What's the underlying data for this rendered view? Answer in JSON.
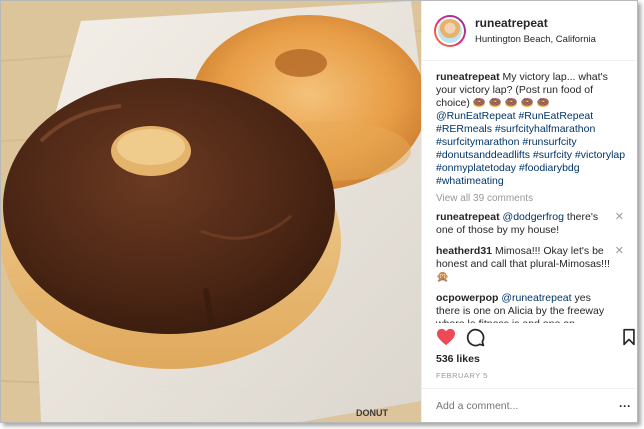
{
  "post": {
    "username": "runeatrepeat",
    "location": "Huntington Beach, California",
    "caption_text": "My victory lap... what's your victory lap? (Post run food of choice)",
    "caption_emoji": "🍩 🍩 🍩 🍩 🍩",
    "hashtags": "@RunEatRepeat #RunEatRepeat #RERmeals #surfcityhalfmarathon #surfcitymarathon #runsurfcity #donutsanddeadlifts #surfcity #victorylap #onmyplatetoday #foodiarybdg #whatimeating",
    "view_all": "View all 39 comments",
    "likes": "536 likes",
    "date": "FEBRUARY 5",
    "add_comment_placeholder": "Add a comment...",
    "more_icon": "more-dots-icon"
  },
  "comments": [
    {
      "user": "runeatrepeat",
      "mention": "@dodgerfrog",
      "text": " there's one of those by my house!"
    },
    {
      "user": "heatherd31",
      "mention": "",
      "text": "Mimosa!!! Okay let's be honest and call that plural-Mimosas!!! 🙊"
    },
    {
      "user": "ocpowerpop",
      "mention": "@runeatrepeat",
      "text": " yes there is one on Alicia by the freeway where la fitness is and one on trabuco and Alicia where smart and final is, I think one in laguna too"
    }
  ],
  "icons": {
    "like": "heart-icon",
    "comment": "comment-bubble-icon",
    "save": "bookmark-icon",
    "remove": "close-icon"
  },
  "colors": {
    "heart": "#ed4956",
    "link": "#003569",
    "muted": "#999999"
  }
}
